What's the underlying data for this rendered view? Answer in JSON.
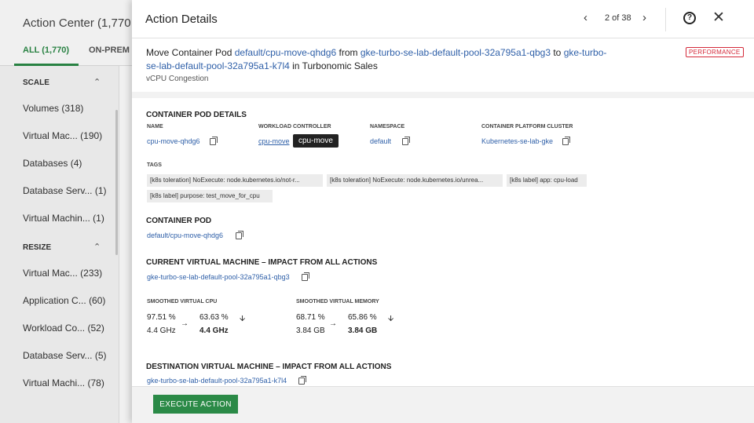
{
  "background": {
    "title": "Action Center (1,770",
    "tabs": [
      {
        "label": "ALL (1,770)"
      },
      {
        "label": "ON-PREM"
      }
    ],
    "groups": [
      {
        "label": "SCALE",
        "items": [
          {
            "name": "Volumes",
            "count": "(318)"
          },
          {
            "name": "Virtual Mac...",
            "count": "(190)"
          },
          {
            "name": "Databases",
            "count": "(4)"
          },
          {
            "name": "Database Serv...",
            "count": "(1)"
          },
          {
            "name": "Virtual Machin...",
            "count": "(1)"
          }
        ]
      },
      {
        "label": "RESIZE",
        "items": [
          {
            "name": "Virtual Mac...",
            "count": "(233)"
          },
          {
            "name": "Application C...",
            "count": "(60)"
          },
          {
            "name": "Workload Co...",
            "count": "(52)"
          },
          {
            "name": "Database Serv...",
            "count": "(5)"
          },
          {
            "name": "Virtual Machi...",
            "count": "(78)"
          }
        ]
      }
    ]
  },
  "drawer": {
    "title": "Action Details",
    "pager": "2 of 38",
    "summary": {
      "prefix": "Move Container Pod ",
      "pod": "default/cpu-move-qhdg6",
      "from_word": " from ",
      "source": "gke-turbo-se-lab-default-pool-32a795a1-qbg3",
      "to_word": " to ",
      "dest": "gke-turbo-se-lab-default-pool-32a795a1-k7l4",
      "suffix": " in Turbonomic Sales",
      "reason": "vCPU Congestion",
      "badge": "PERFORMANCE"
    },
    "details": {
      "title": "CONTAINER POD DETAILS",
      "name_label": "NAME",
      "name_value": "cpu-move-qhdg6",
      "controller_label": "WORKLOAD CONTROLLER",
      "controller_value": "cpu-move",
      "tooltip": "cpu-move",
      "namespace_label": "NAMESPACE",
      "namespace_value": "default",
      "cluster_label": "CONTAINER PLATFORM CLUSTER",
      "cluster_value": "Kubernetes-se-lab-gke",
      "tags_label": "TAGS",
      "tags": [
        "[k8s toleration] NoExecute: node.kubernetes.io/not-r...",
        "[k8s toleration] NoExecute: node.kubernetes.io/unrea...",
        "[k8s label] app: cpu-load",
        "[k8s label] purpose: test_move_for_cpu"
      ]
    },
    "container_pod": {
      "title": "CONTAINER POD",
      "value": "default/cpu-move-qhdg6"
    },
    "current_vm": {
      "title": "CURRENT VIRTUAL MACHINE – IMPACT FROM ALL ACTIONS",
      "value": "gke-turbo-se-lab-default-pool-32a795a1-qbg3",
      "cpu_label": "SMOOTHED VIRTUAL CPU",
      "cpu_before_pct": "97.51 %",
      "cpu_before_abs": "4.4 GHz",
      "cpu_after_pct": "63.63 %",
      "cpu_after_abs": "4.4 GHz",
      "mem_label": "SMOOTHED VIRTUAL MEMORY",
      "mem_before_pct": "68.71 %",
      "mem_before_abs": "3.84 GB",
      "mem_after_pct": "65.86 %",
      "mem_after_abs": "3.84 GB"
    },
    "dest_vm": {
      "title": "DESTINATION VIRTUAL MACHINE – IMPACT FROM ALL ACTIONS",
      "value": "gke-turbo-se-lab-default-pool-32a795a1-k7l4"
    },
    "execute_label": "EXECUTE ACTION"
  },
  "colors": {
    "accent_green": "#2b8a47",
    "link_blue": "#2e5fa8",
    "badge_red": "#d42a3a"
  }
}
